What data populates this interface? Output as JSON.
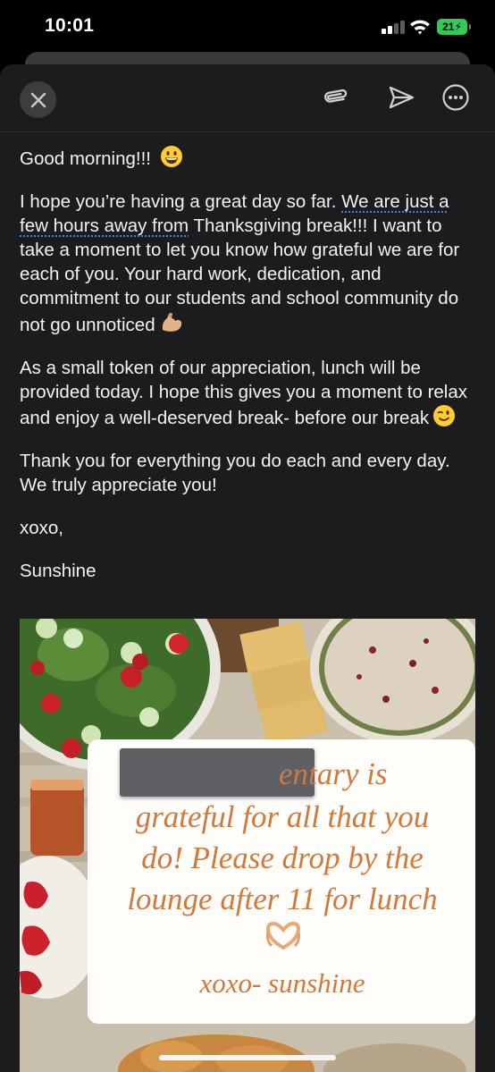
{
  "status_bar": {
    "time": "10:01",
    "battery": "21"
  },
  "toolbar": {
    "close_icon": "close-icon",
    "attach_icon": "paperclip-icon",
    "send_icon": "send-icon",
    "more_icon": "more-icon"
  },
  "email": {
    "greeting": "Good morning!!!",
    "p1_a": "I hope you’re having a great day so far. ",
    "p1_b": "We are just a few hours away from",
    "p1_c": " Thanksgiving break!!! I want to take a moment to let you know how grateful we are for each of you. Your hard work, dedication, and commitment to our students and school community do not go unnoticed",
    "p2": "As a small token of our appreciation, lunch will be provided today. I hope this gives you a moment to relax and enjoy a well-deserved break- before our break",
    "p3": "Thank you for everything you do each and every day. We truly appreciate you!",
    "signoff": "xoxo,",
    "signature": "Sunshine"
  },
  "flyer": {
    "line1": "entary is",
    "line2": "grateful for all that you",
    "line3": "do! Please drop by the",
    "line4": "lounge after 11 for lunch",
    "line5": "xoxo- sunshine"
  },
  "colors": {
    "background": "#1c1c1e",
    "text": "#f2f2f2",
    "flyer_text": "#d0793c",
    "battery": "#34c759"
  }
}
